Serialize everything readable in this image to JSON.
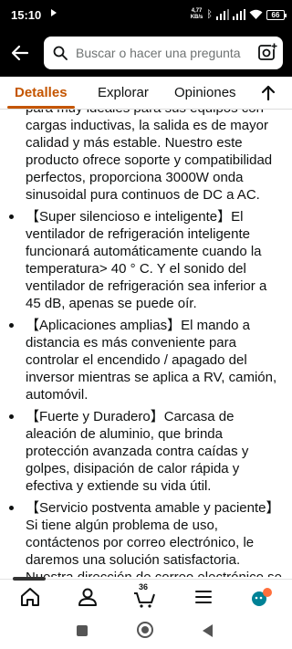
{
  "status_bar": {
    "time": "15:10",
    "speed_value": "4,77",
    "speed_unit": "KB/s",
    "battery": "66"
  },
  "search": {
    "placeholder": "Buscar o hacer una pregunta"
  },
  "tabs": [
    {
      "label": "Detalles",
      "active": true
    },
    {
      "label": "Explorar",
      "active": false
    },
    {
      "label": "Opiniones",
      "active": false
    }
  ],
  "bullets": [
    "para muy ideales para sus equipos con cargas inductivas, la salida es de mayor calidad y más estable. Nuestro este producto ofrece soporte y compatibilidad perfectos, proporciona 3000W onda sinusoidal pura continuos de DC a AC.",
    "【Super silencioso e inteligente】El ventilador de refrigeración inteligente funcionará automáticamente cuando la temperatura> 40 ° C. Y el sonido del ventilador de refrigeración sea inferior a 45 dB, apenas se puede oír.",
    "【Aplicaciones amplias】El mando a distancia es más conveniente para controlar el encendido / apagado del inversor mientras se aplica a RV, camión, automóvil.",
    "【Fuerte y Duradero】Carcasa de aleación de aluminio, que brinda protección avanzada contra caídas y golpes, disipación de calor rápida y efectiva y extiende su vida útil.",
    "【Servicio postventa amable y paciente】Si tiene algún problema de uso, contáctenos por correo electrónico, le daremos una solución satisfactoria. Nuestra dirección de correo electrónico se puede encontrar en el manual del"
  ],
  "bottom_nav": {
    "cart_count": "36",
    "accent_color": "#008296",
    "active_color": "#0f1111"
  },
  "colors": {
    "header_bg": "#000000",
    "tab_active": "#c45500"
  }
}
